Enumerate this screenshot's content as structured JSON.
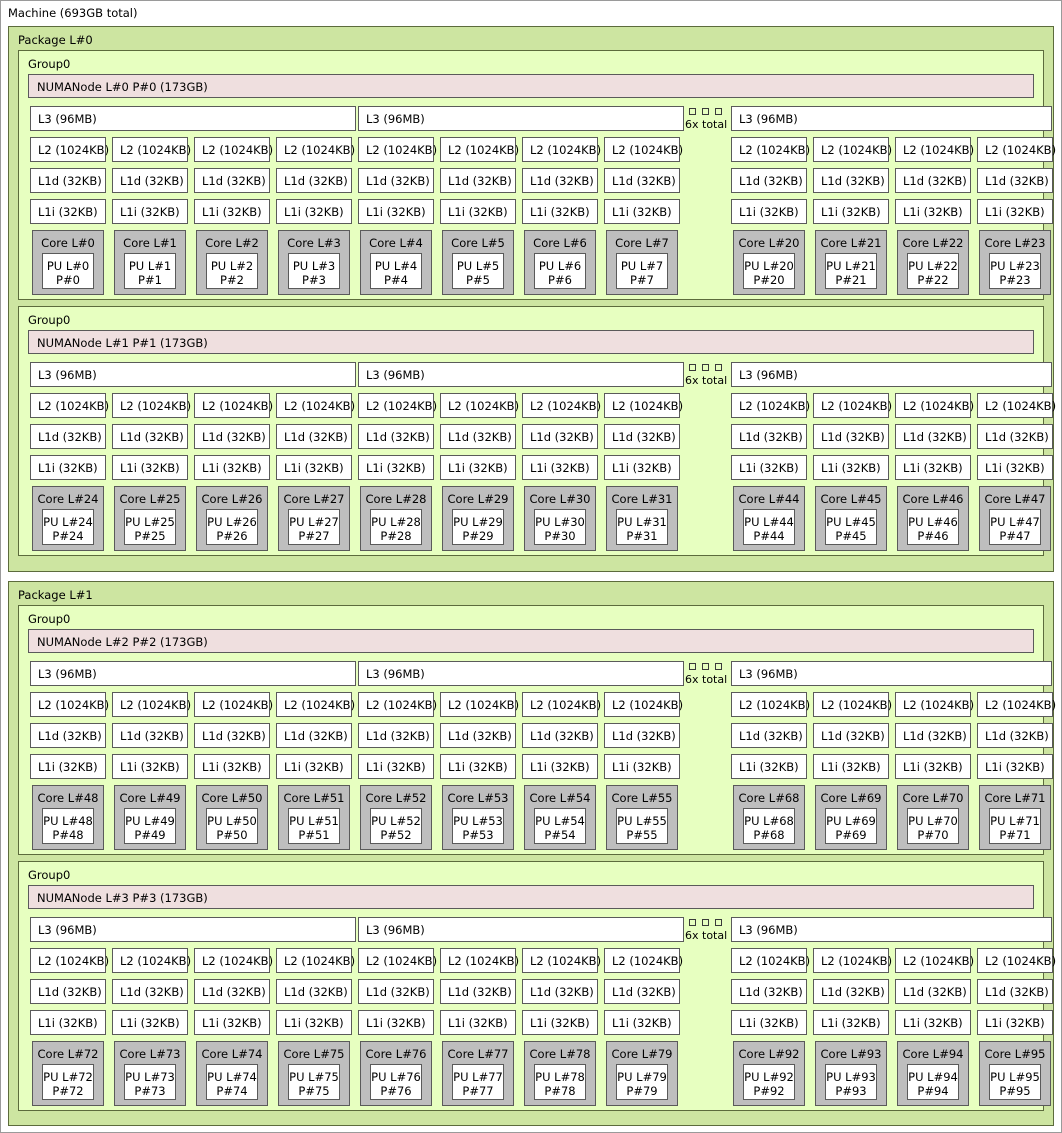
{
  "machine": {
    "label": "Machine (693GB total)"
  },
  "colors": {
    "package_fill": "#cde5a1",
    "group_fill": "#e7ffc0",
    "numanode_fill": "#efdfdf",
    "cache_fill": "#ffffff",
    "core_fill": "#bebebe",
    "pu_fill": "#ffffff",
    "border": "#5a5a5a",
    "green_border": "#5c6b3c",
    "page_bg": "#ffffff"
  },
  "ellipsis": {
    "label": "6x total",
    "square_count": 3
  },
  "labels": {
    "l3": "L3 (96MB)",
    "l2": "L2 (1024KB)",
    "l1d": "L1d (32KB)",
    "l1i": "L1i (32KB)"
  },
  "packages": [
    {
      "label": "Package L#0",
      "groups": [
        {
          "label": "Group0",
          "numanode": "NUMANode L#0 P#0 (173GB)",
          "l3_left": "L3 (96MB)",
          "l3_mid": "L3 (96MB)",
          "l3_right": "L3 (96MB)",
          "left_cores": [
            {
              "core": "Core L#0",
              "pu_l": "PU L#0",
              "pu_p": "P#0",
              "l2": "L2 (1024KB)",
              "l1d": "L1d (32KB)",
              "l1i": "L1i (32KB)"
            },
            {
              "core": "Core L#1",
              "pu_l": "PU L#1",
              "pu_p": "P#1",
              "l2": "L2 (1024KB)",
              "l1d": "L1d (32KB)",
              "l1i": "L1i (32KB)"
            },
            {
              "core": "Core L#2",
              "pu_l": "PU L#2",
              "pu_p": "P#2",
              "l2": "L2 (1024KB)",
              "l1d": "L1d (32KB)",
              "l1i": "L1i (32KB)"
            },
            {
              "core": "Core L#3",
              "pu_l": "PU L#3",
              "pu_p": "P#3",
              "l2": "L2 (1024KB)",
              "l1d": "L1d (32KB)",
              "l1i": "L1i (32KB)"
            },
            {
              "core": "Core L#4",
              "pu_l": "PU L#4",
              "pu_p": "P#4",
              "l2": "L2 (1024KB)",
              "l1d": "L1d (32KB)",
              "l1i": "L1i (32KB)"
            },
            {
              "core": "Core L#5",
              "pu_l": "PU L#5",
              "pu_p": "P#5",
              "l2": "L2 (1024KB)",
              "l1d": "L1d (32KB)",
              "l1i": "L1i (32KB)"
            },
            {
              "core": "Core L#6",
              "pu_l": "PU L#6",
              "pu_p": "P#6",
              "l2": "L2 (1024KB)",
              "l1d": "L1d (32KB)",
              "l1i": "L1i (32KB)"
            },
            {
              "core": "Core L#7",
              "pu_l": "PU L#7",
              "pu_p": "P#7",
              "l2": "L2 (1024KB)",
              "l1d": "L1d (32KB)",
              "l1i": "L1i (32KB)"
            }
          ],
          "right_cores": [
            {
              "core": "Core L#20",
              "pu_l": "PU L#20",
              "pu_p": "P#20",
              "l2": "L2 (1024KB)",
              "l1d": "L1d (32KB)",
              "l1i": "L1i (32KB)"
            },
            {
              "core": "Core L#21",
              "pu_l": "PU L#21",
              "pu_p": "P#21",
              "l2": "L2 (1024KB)",
              "l1d": "L1d (32KB)",
              "l1i": "L1i (32KB)"
            },
            {
              "core": "Core L#22",
              "pu_l": "PU L#22",
              "pu_p": "P#22",
              "l2": "L2 (1024KB)",
              "l1d": "L1d (32KB)",
              "l1i": "L1i (32KB)"
            },
            {
              "core": "Core L#23",
              "pu_l": "PU L#23",
              "pu_p": "P#23",
              "l2": "L2 (1024KB)",
              "l1d": "L1d (32KB)",
              "l1i": "L1i (32KB)"
            }
          ]
        },
        {
          "label": "Group0",
          "numanode": "NUMANode L#1 P#1 (173GB)",
          "l3_left": "L3 (96MB)",
          "l3_mid": "L3 (96MB)",
          "l3_right": "L3 (96MB)",
          "left_cores": [
            {
              "core": "Core L#24",
              "pu_l": "PU L#24",
              "pu_p": "P#24",
              "l2": "L2 (1024KB)",
              "l1d": "L1d (32KB)",
              "l1i": "L1i (32KB)"
            },
            {
              "core": "Core L#25",
              "pu_l": "PU L#25",
              "pu_p": "P#25",
              "l2": "L2 (1024KB)",
              "l1d": "L1d (32KB)",
              "l1i": "L1i (32KB)"
            },
            {
              "core": "Core L#26",
              "pu_l": "PU L#26",
              "pu_p": "P#26",
              "l2": "L2 (1024KB)",
              "l1d": "L1d (32KB)",
              "l1i": "L1i (32KB)"
            },
            {
              "core": "Core L#27",
              "pu_l": "PU L#27",
              "pu_p": "P#27",
              "l2": "L2 (1024KB)",
              "l1d": "L1d (32KB)",
              "l1i": "L1i (32KB)"
            },
            {
              "core": "Core L#28",
              "pu_l": "PU L#28",
              "pu_p": "P#28",
              "l2": "L2 (1024KB)",
              "l1d": "L1d (32KB)",
              "l1i": "L1i (32KB)"
            },
            {
              "core": "Core L#29",
              "pu_l": "PU L#29",
              "pu_p": "P#29",
              "l2": "L2 (1024KB)",
              "l1d": "L1d (32KB)",
              "l1i": "L1i (32KB)"
            },
            {
              "core": "Core L#30",
              "pu_l": "PU L#30",
              "pu_p": "P#30",
              "l2": "L2 (1024KB)",
              "l1d": "L1d (32KB)",
              "l1i": "L1i (32KB)"
            },
            {
              "core": "Core L#31",
              "pu_l": "PU L#31",
              "pu_p": "P#31",
              "l2": "L2 (1024KB)",
              "l1d": "L1d (32KB)",
              "l1i": "L1i (32KB)"
            }
          ],
          "right_cores": [
            {
              "core": "Core L#44",
              "pu_l": "PU L#44",
              "pu_p": "P#44",
              "l2": "L2 (1024KB)",
              "l1d": "L1d (32KB)",
              "l1i": "L1i (32KB)"
            },
            {
              "core": "Core L#45",
              "pu_l": "PU L#45",
              "pu_p": "P#45",
              "l2": "L2 (1024KB)",
              "l1d": "L1d (32KB)",
              "l1i": "L1i (32KB)"
            },
            {
              "core": "Core L#46",
              "pu_l": "PU L#46",
              "pu_p": "P#46",
              "l2": "L2 (1024KB)",
              "l1d": "L1d (32KB)",
              "l1i": "L1i (32KB)"
            },
            {
              "core": "Core L#47",
              "pu_l": "PU L#47",
              "pu_p": "P#47",
              "l2": "L2 (1024KB)",
              "l1d": "L1d (32KB)",
              "l1i": "L1i (32KB)"
            }
          ]
        }
      ]
    },
    {
      "label": "Package L#1",
      "groups": [
        {
          "label": "Group0",
          "numanode": "NUMANode L#2 P#2 (173GB)",
          "l3_left": "L3 (96MB)",
          "l3_mid": "L3 (96MB)",
          "l3_right": "L3 (96MB)",
          "left_cores": [
            {
              "core": "Core L#48",
              "pu_l": "PU L#48",
              "pu_p": "P#48",
              "l2": "L2 (1024KB)",
              "l1d": "L1d (32KB)",
              "l1i": "L1i (32KB)"
            },
            {
              "core": "Core L#49",
              "pu_l": "PU L#49",
              "pu_p": "P#49",
              "l2": "L2 (1024KB)",
              "l1d": "L1d (32KB)",
              "l1i": "L1i (32KB)"
            },
            {
              "core": "Core L#50",
              "pu_l": "PU L#50",
              "pu_p": "P#50",
              "l2": "L2 (1024KB)",
              "l1d": "L1d (32KB)",
              "l1i": "L1i (32KB)"
            },
            {
              "core": "Core L#51",
              "pu_l": "PU L#51",
              "pu_p": "P#51",
              "l2": "L2 (1024KB)",
              "l1d": "L1d (32KB)",
              "l1i": "L1i (32KB)"
            },
            {
              "core": "Core L#52",
              "pu_l": "PU L#52",
              "pu_p": "P#52",
              "l2": "L2 (1024KB)",
              "l1d": "L1d (32KB)",
              "l1i": "L1i (32KB)"
            },
            {
              "core": "Core L#53",
              "pu_l": "PU L#53",
              "pu_p": "P#53",
              "l2": "L2 (1024KB)",
              "l1d": "L1d (32KB)",
              "l1i": "L1i (32KB)"
            },
            {
              "core": "Core L#54",
              "pu_l": "PU L#54",
              "pu_p": "P#54",
              "l2": "L2 (1024KB)",
              "l1d": "L1d (32KB)",
              "l1i": "L1i (32KB)"
            },
            {
              "core": "Core L#55",
              "pu_l": "PU L#55",
              "pu_p": "P#55",
              "l2": "L2 (1024KB)",
              "l1d": "L1d (32KB)",
              "l1i": "L1i (32KB)"
            }
          ],
          "right_cores": [
            {
              "core": "Core L#68",
              "pu_l": "PU L#68",
              "pu_p": "P#68",
              "l2": "L2 (1024KB)",
              "l1d": "L1d (32KB)",
              "l1i": "L1i (32KB)"
            },
            {
              "core": "Core L#69",
              "pu_l": "PU L#69",
              "pu_p": "P#69",
              "l2": "L2 (1024KB)",
              "l1d": "L1d (32KB)",
              "l1i": "L1i (32KB)"
            },
            {
              "core": "Core L#70",
              "pu_l": "PU L#70",
              "pu_p": "P#70",
              "l2": "L2 (1024KB)",
              "l1d": "L1d (32KB)",
              "l1i": "L1i (32KB)"
            },
            {
              "core": "Core L#71",
              "pu_l": "PU L#71",
              "pu_p": "P#71",
              "l2": "L2 (1024KB)",
              "l1d": "L1d (32KB)",
              "l1i": "L1i (32KB)"
            }
          ]
        },
        {
          "label": "Group0",
          "numanode": "NUMANode L#3 P#3 (173GB)",
          "l3_left": "L3 (96MB)",
          "l3_mid": "L3 (96MB)",
          "l3_right": "L3 (96MB)",
          "left_cores": [
            {
              "core": "Core L#72",
              "pu_l": "PU L#72",
              "pu_p": "P#72",
              "l2": "L2 (1024KB)",
              "l1d": "L1d (32KB)",
              "l1i": "L1i (32KB)"
            },
            {
              "core": "Core L#73",
              "pu_l": "PU L#73",
              "pu_p": "P#73",
              "l2": "L2 (1024KB)",
              "l1d": "L1d (32KB)",
              "l1i": "L1i (32KB)"
            },
            {
              "core": "Core L#74",
              "pu_l": "PU L#74",
              "pu_p": "P#74",
              "l2": "L2 (1024KB)",
              "l1d": "L1d (32KB)",
              "l1i": "L1i (32KB)"
            },
            {
              "core": "Core L#75",
              "pu_l": "PU L#75",
              "pu_p": "P#75",
              "l2": "L2 (1024KB)",
              "l1d": "L1d (32KB)",
              "l1i": "L1i (32KB)"
            },
            {
              "core": "Core L#76",
              "pu_l": "PU L#76",
              "pu_p": "P#76",
              "l2": "L2 (1024KB)",
              "l1d": "L1d (32KB)",
              "l1i": "L1i (32KB)"
            },
            {
              "core": "Core L#77",
              "pu_l": "PU L#77",
              "pu_p": "P#77",
              "l2": "L2 (1024KB)",
              "l1d": "L1d (32KB)",
              "l1i": "L1i (32KB)"
            },
            {
              "core": "Core L#78",
              "pu_l": "PU L#78",
              "pu_p": "P#78",
              "l2": "L2 (1024KB)",
              "l1d": "L1d (32KB)",
              "l1i": "L1i (32KB)"
            },
            {
              "core": "Core L#79",
              "pu_l": "PU L#79",
              "pu_p": "P#79",
              "l2": "L2 (1024KB)",
              "l1d": "L1d (32KB)",
              "l1i": "L1i (32KB)"
            }
          ],
          "right_cores": [
            {
              "core": "Core L#92",
              "pu_l": "PU L#92",
              "pu_p": "P#92",
              "l2": "L2 (1024KB)",
              "l1d": "L1d (32KB)",
              "l1i": "L1i (32KB)"
            },
            {
              "core": "Core L#93",
              "pu_l": "PU L#93",
              "pu_p": "P#93",
              "l2": "L2 (1024KB)",
              "l1d": "L1d (32KB)",
              "l1i": "L1i (32KB)"
            },
            {
              "core": "Core L#94",
              "pu_l": "PU L#94",
              "pu_p": "P#94",
              "l2": "L2 (1024KB)",
              "l1d": "L1d (32KB)",
              "l1i": "L1i (32KB)"
            },
            {
              "core": "Core L#95",
              "pu_l": "PU L#95",
              "pu_p": "P#95",
              "l2": "L2 (1024KB)",
              "l1d": "L1d (32KB)",
              "l1i": "L1i (32KB)"
            }
          ]
        }
      ]
    }
  ]
}
